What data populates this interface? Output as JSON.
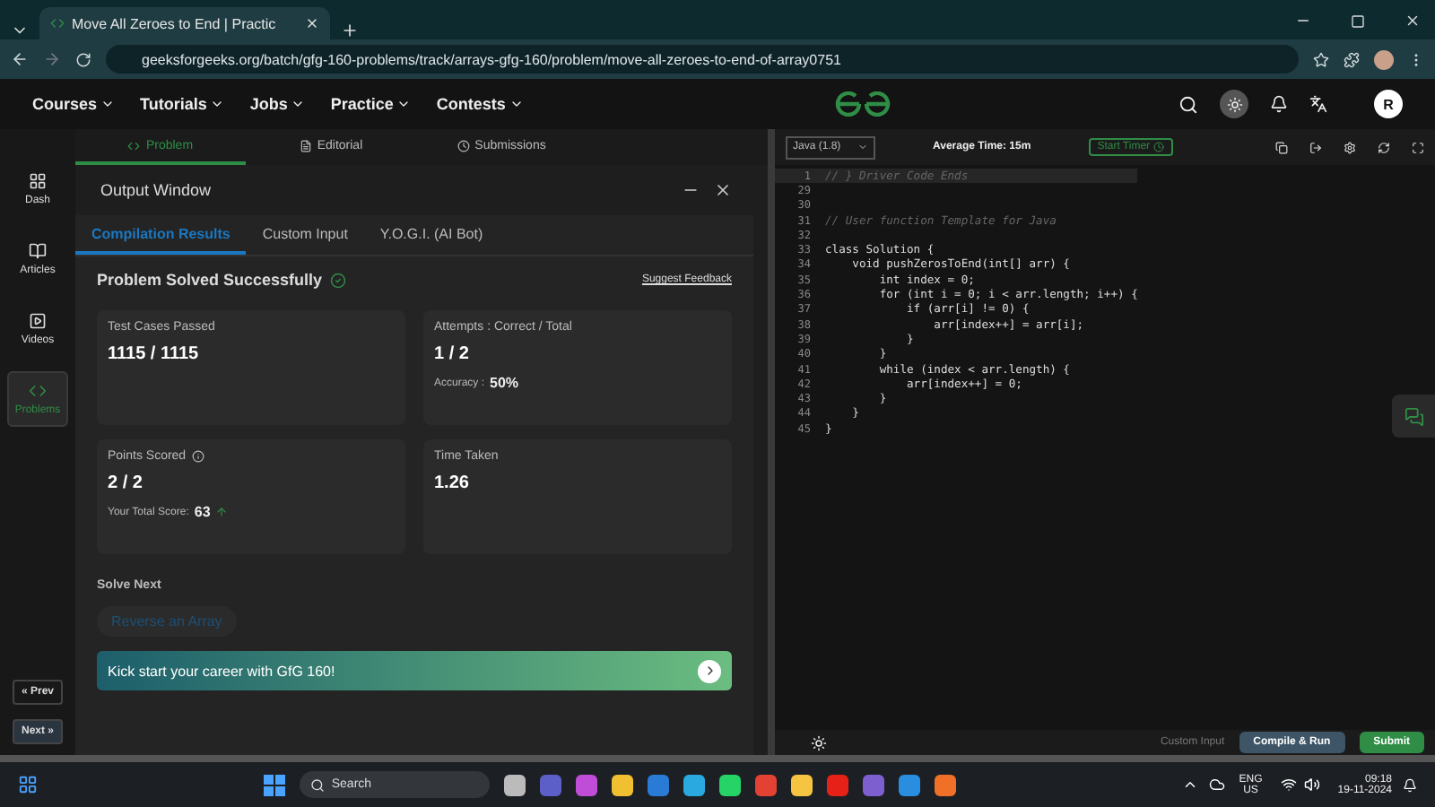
{
  "browser": {
    "tab_title": "Move All Zeroes to End | Practic",
    "url": "geeksforgeeks.org/batch/gfg-160-problems/track/arrays-gfg-160/problem/move-all-zeroes-to-end-of-array0751"
  },
  "site_nav": {
    "menus": [
      "Courses",
      "Tutorials",
      "Jobs",
      "Practice",
      "Contests"
    ],
    "avatar": "R"
  },
  "sidebar": {
    "items": [
      {
        "label": "Dash",
        "selected": false
      },
      {
        "label": "Articles",
        "selected": false
      },
      {
        "label": "Videos",
        "selected": false
      },
      {
        "label": "Problems",
        "selected": true
      }
    ],
    "prev": "« Prev",
    "next": "Next »"
  },
  "problem_tabs": [
    {
      "label": "Problem",
      "selected": true
    },
    {
      "label": "Editorial",
      "selected": false
    },
    {
      "label": "Submissions",
      "selected": false
    }
  ],
  "output_window": {
    "title": "Output Window",
    "tabs": [
      {
        "label": "Compilation Results",
        "selected": true
      },
      {
        "label": "Custom Input",
        "selected": false
      },
      {
        "label": "Y.O.G.I. (AI Bot)",
        "selected": false
      }
    ],
    "status": "Problem Solved Successfully",
    "feedback_link": "Suggest Feedback",
    "cards": [
      {
        "label": "Test Cases Passed",
        "value": "1115 / 1115"
      },
      {
        "label": "Attempts : Correct / Total",
        "value": "1 / 2",
        "note_label": "Accuracy :",
        "note_value": "50%"
      },
      {
        "label": "Points Scored",
        "value": "2 / 2",
        "note_label": "Your Total Score:",
        "note_value": "63",
        "info": true,
        "trend_up": true
      },
      {
        "label": "Time Taken",
        "value": "1.26"
      }
    ],
    "solve_next_heading": "Solve Next",
    "next_problem": "Reverse an Array",
    "banner": "Kick start your career with GfG 160!"
  },
  "editor": {
    "language": "Java (1.8)",
    "average_time": "Average Time: 15m",
    "timer_button": "Start Timer",
    "lines": [
      {
        "number": "1",
        "text": "// } Driver Code Ends",
        "kind": "folded"
      },
      {
        "number": "29",
        "kind": "code"
      },
      {
        "number": "30",
        "kind": "code"
      },
      {
        "number": "31",
        "text": "// User function Template for Java",
        "kind": "comment"
      },
      {
        "number": "32",
        "kind": "code"
      },
      {
        "number": "33",
        "text": "class Solution {",
        "kind": "code"
      },
      {
        "number": "34",
        "text": "    void pushZerosToEnd(int[] arr) {",
        "kind": "code"
      },
      {
        "number": "35",
        "text": "        int index = 0;",
        "kind": "code"
      },
      {
        "number": "36",
        "text": "        for (int i = 0; i < arr.length; i++) {",
        "kind": "code"
      },
      {
        "number": "37",
        "text": "            if (arr[i] != 0) {",
        "kind": "code"
      },
      {
        "number": "38",
        "text": "                arr[index++] = arr[i];",
        "kind": "code"
      },
      {
        "number": "39",
        "text": "            }",
        "kind": "code"
      },
      {
        "number": "40",
        "text": "        }",
        "kind": "code"
      },
      {
        "number": "41",
        "text": "        while (index < arr.length) {",
        "kind": "code"
      },
      {
        "number": "42",
        "text": "            arr[index++] = 0;",
        "kind": "code"
      },
      {
        "number": "43",
        "text": "        }",
        "kind": "code"
      },
      {
        "number": "44",
        "text": "    }",
        "kind": "code"
      },
      {
        "number": "45",
        "text": "}",
        "kind": "code"
      }
    ],
    "custom_input": "Custom Input",
    "compile_button": "Compile & Run",
    "submit_button": "Submit"
  },
  "taskbar": {
    "search": "Search",
    "language": "ENG",
    "region": "US",
    "time": "09:18",
    "date": "19-11-2024"
  }
}
